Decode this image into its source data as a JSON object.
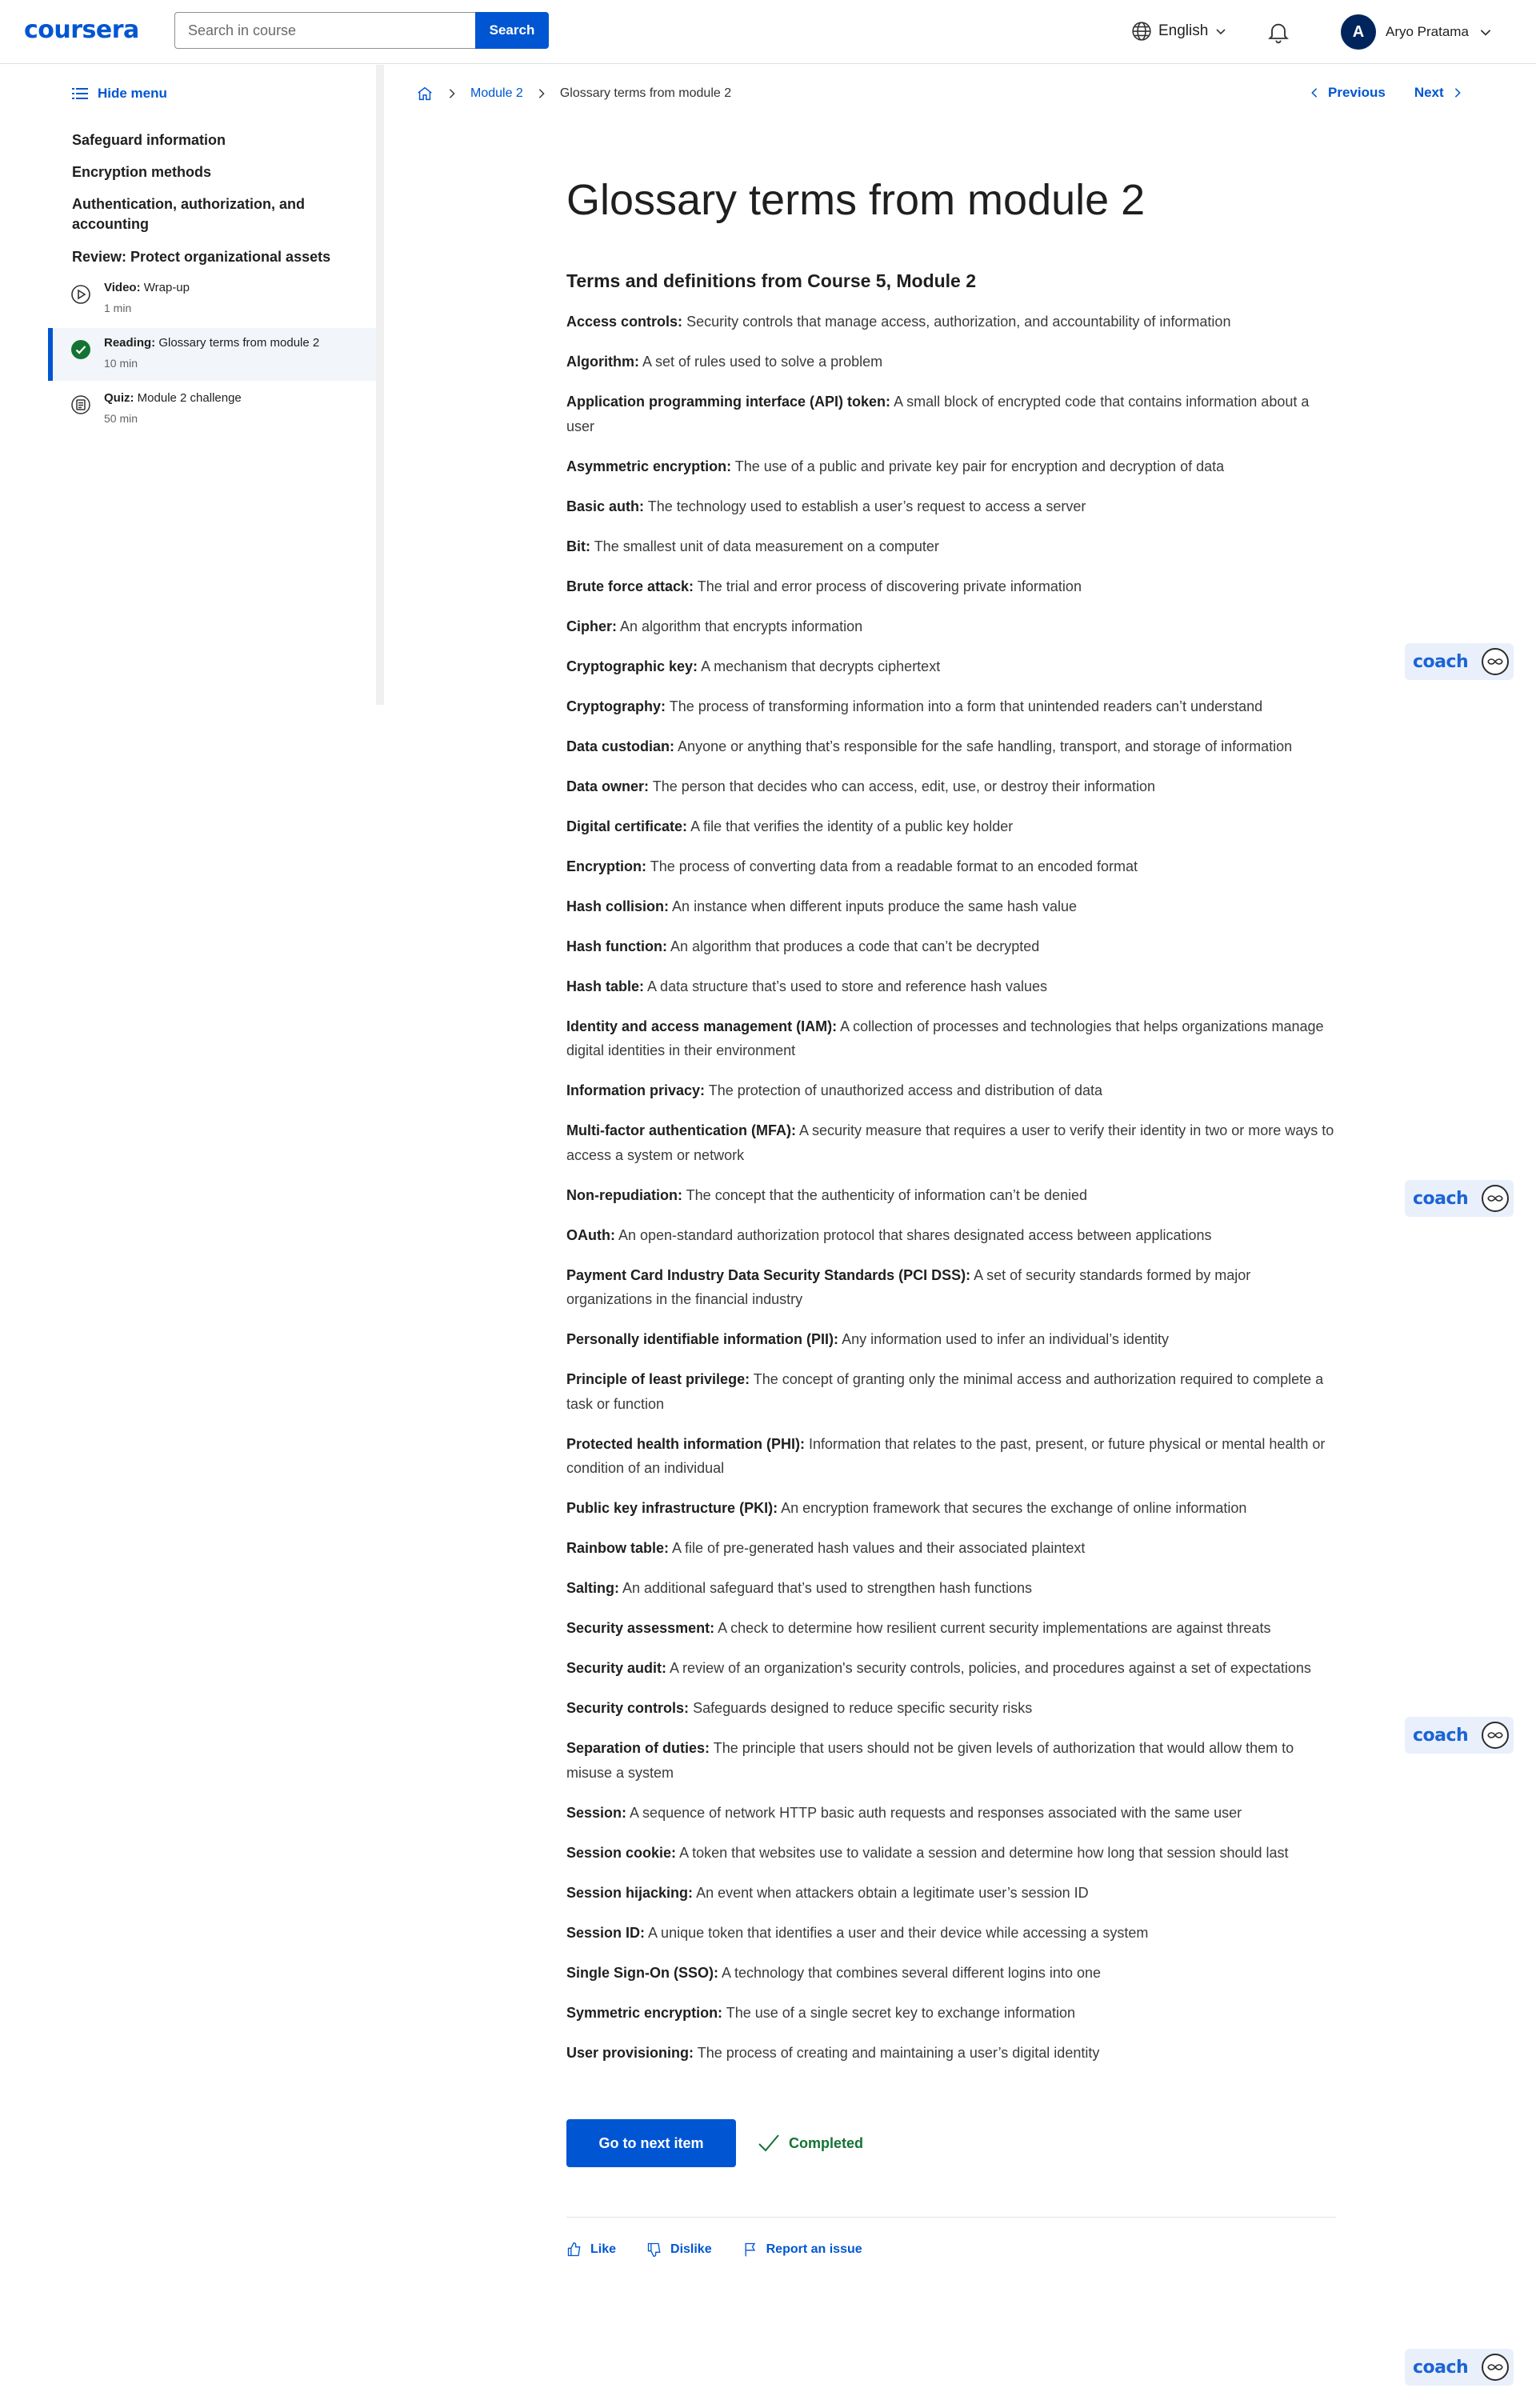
{
  "header": {
    "logo": "coursera",
    "search_placeholder": "Search in course",
    "search_button": "Search",
    "language": "English",
    "user_initial": "A",
    "user_name": "Aryo Pratama"
  },
  "sidebar": {
    "hide_menu": "Hide menu",
    "sections": [
      "Safeguard information",
      "Encryption methods",
      "Authentication, authorization, and accounting",
      "Review: Protect organizational assets"
    ],
    "items": [
      {
        "type": "Video:",
        "title": "Wrap-up",
        "duration": "1 min"
      },
      {
        "type": "Reading:",
        "title": "Glossary terms from module 2",
        "duration": "10 min"
      },
      {
        "type": "Quiz:",
        "title": "Module 2 challenge",
        "duration": "50 min"
      }
    ]
  },
  "breadcrumb": {
    "module": "Module 2",
    "current": "Glossary terms from module 2"
  },
  "nav": {
    "previous": "Previous",
    "next": "Next"
  },
  "main": {
    "title": "Glossary terms from module 2",
    "subtitle": "Terms and definitions from Course 5, Module 2",
    "terms": [
      {
        "term": "Access controls:",
        "def": "Security controls that manage access, authorization, and accountability of information"
      },
      {
        "term": "Algorithm:",
        "def": "A set of rules used to solve a problem"
      },
      {
        "term": "Application programming interface (API) token:",
        "def": "A small block of encrypted code that contains information about a user"
      },
      {
        "term": "Asymmetric encryption:",
        "def": "The use of a public and private key pair for encryption and decryption of data"
      },
      {
        "term": "Basic auth:",
        "def": "The technology used to establish a user’s request to access a server"
      },
      {
        "term": "Bit:",
        "def": "The smallest unit of data measurement on a computer"
      },
      {
        "term": "Brute force attack:",
        "def": "The trial and error process of discovering private information"
      },
      {
        "term": "Cipher:",
        "def": "An algorithm that encrypts information"
      },
      {
        "term": "Cryptographic key:",
        "def": "A mechanism that decrypts ciphertext"
      },
      {
        "term": "Cryptography:",
        "def": "The process of transforming information into a form that unintended readers can’t understand"
      },
      {
        "term": "Data custodian:",
        "def": "Anyone or anything that’s responsible for the safe handling, transport, and storage of information"
      },
      {
        "term": "Data owner:",
        "def": "The person that decides who can access, edit, use, or destroy their information"
      },
      {
        "term": "Digital certificate:",
        "def": "A file that verifies the identity of a public key holder"
      },
      {
        "term": "Encryption:",
        "def": "The process of converting data from a readable format to an encoded format"
      },
      {
        "term": "Hash collision:",
        "def": "An instance when different inputs produce the same hash value"
      },
      {
        "term": "Hash function:",
        "def": "An algorithm that produces a code that can’t be decrypted"
      },
      {
        "term": "Hash table:",
        "def": "A data structure that’s used to store and reference hash values"
      },
      {
        "term": "Identity and access management (IAM):",
        "def": "A collection of processes and technologies that helps organizations manage digital identities in their environment"
      },
      {
        "term": "Information privacy:",
        "def": "The protection of unauthorized access and distribution of data"
      },
      {
        "term": "Multi-factor authentication (MFA):",
        "def": "A security measure that requires a user to verify their identity in two or more ways to access a system or network"
      },
      {
        "term": "Non-repudiation:",
        "def": "The concept that the authenticity of information can’t be denied"
      },
      {
        "term": "OAuth:",
        "def": "An open-standard authorization protocol that shares designated access between applications"
      },
      {
        "term": "Payment Card Industry Data Security Standards (PCI DSS):",
        "def": "A set of security standards formed by major organizations in the financial industry"
      },
      {
        "term": "Personally identifiable information (PII):",
        "def": "Any information used to infer an individual’s identity"
      },
      {
        "term": "Principle of least privilege:",
        "def": "The concept of granting only the minimal access and authorization required to complete a task or function"
      },
      {
        "term": "Protected health information (PHI):",
        "def": "Information that relates to the past, present, or future physical or mental health or condition of an individual"
      },
      {
        "term": "Public key infrastructure (PKI):",
        "def": "An encryption framework that secures the exchange of online information"
      },
      {
        "term": "Rainbow table:",
        "def": "A file of pre-generated hash values and their associated plaintext"
      },
      {
        "term": "Salting:",
        "def": "An additional safeguard that’s used to strengthen hash functions"
      },
      {
        "term": "Security assessment:",
        "def": "A check to determine how resilient current security implementations are against threats"
      },
      {
        "term": "Security audit:",
        "def": "A review of an organization's security controls, policies, and procedures against a set of expectations"
      },
      {
        "term": "Security controls:",
        "def": "Safeguards designed to reduce specific security risks"
      },
      {
        "term": "Separation of duties:",
        "def": "The principle that users should not be given levels of authorization that would allow them to misuse a system"
      },
      {
        "term": "Session:",
        "def": "A sequence of network HTTP basic auth requests and responses associated with the same user"
      },
      {
        "term": "Session cookie:",
        "def": "A token that websites use to validate a session and determine how long that session should last"
      },
      {
        "term": "Session hijacking:",
        "def": "An event when attackers obtain a legitimate user’s session ID"
      },
      {
        "term": "Session ID:",
        "def": "A unique token that identifies a user and their device while accessing a system"
      },
      {
        "term": "Single Sign-On (SSO):",
        "def": "A technology that combines several different logins into one"
      },
      {
        "term": "Symmetric encryption:",
        "def": "The use of a single secret key to exchange information"
      },
      {
        "term": "User provisioning:",
        "def": "The process of creating and maintaining a user’s digital identity"
      }
    ],
    "next_button": "Go to next item",
    "completed": "Completed",
    "like": "Like",
    "dislike": "Dislike",
    "report": "Report an issue"
  },
  "coach": {
    "label": "coach"
  },
  "colors": {
    "accent": "#0056d2",
    "success": "#137333",
    "active_bg": "#f2f5fa"
  }
}
